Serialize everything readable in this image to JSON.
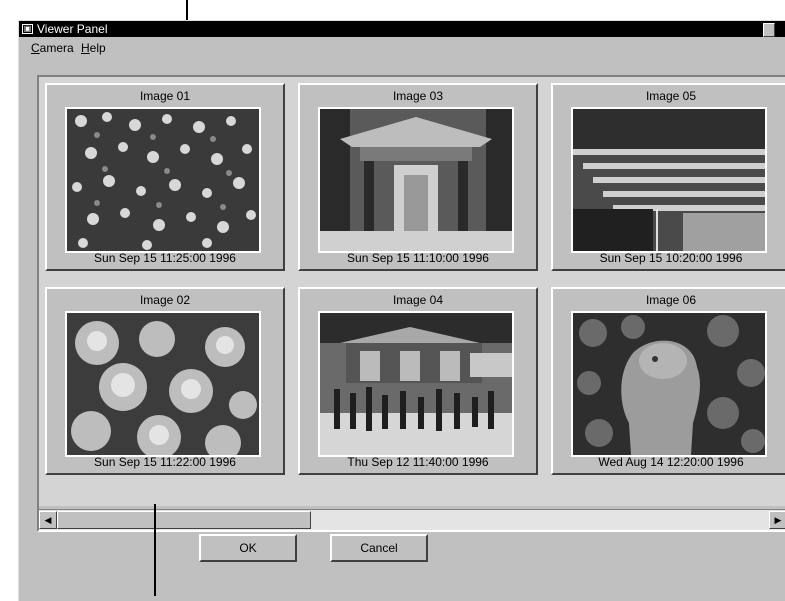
{
  "window": {
    "title": "Viewer Panel"
  },
  "menu": [
    {
      "label": "Camera",
      "accel": "C",
      "rest": "amera"
    },
    {
      "label": "Help",
      "accel": "H",
      "rest": "elp"
    }
  ],
  "images": [
    {
      "title": "Image 01",
      "date": "Sun Sep 15 11:25:00 1996",
      "subject": "flowers"
    },
    {
      "title": "Image 03",
      "date": "Sun Sep 15 11:10:00 1996",
      "subject": "gate"
    },
    {
      "title": "Image 05",
      "date": "Sun Sep 15 10:20:00 1996",
      "subject": "stairs"
    },
    {
      "title": "Image 02",
      "date": "Sun Sep 15 11:22:00 1996",
      "subject": "hydrangeas"
    },
    {
      "title": "Image 04",
      "date": "Thu Sep 12 11:40:00 1996",
      "subject": "shrine-crowd"
    },
    {
      "title": "Image 06",
      "date": "Wed Aug 14 12:20:00 1996",
      "subject": "statue"
    }
  ],
  "buttons": {
    "ok": "OK",
    "cancel": "Cancel"
  },
  "icons": {
    "scroll_left": "left-arrow-icon",
    "scroll_right": "right-arrow-icon"
  }
}
